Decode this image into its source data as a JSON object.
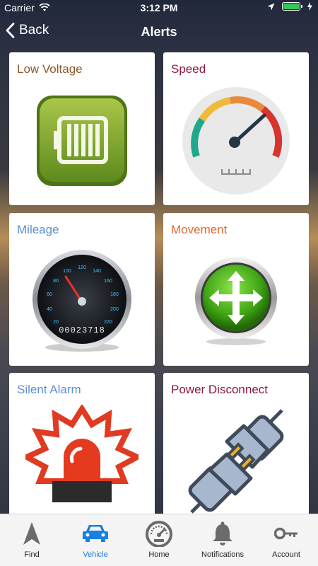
{
  "status_bar": {
    "carrier": "Carrier",
    "time": "3:12 PM"
  },
  "nav": {
    "back_label": "Back",
    "title": "Alerts"
  },
  "alerts": [
    {
      "label": "Low Voltage",
      "color": "#8b5a2b",
      "icon": "battery-icon"
    },
    {
      "label": "Speed",
      "color": "#8b1a3a",
      "icon": "speed-gauge-icon"
    },
    {
      "label": "Mileage",
      "color": "#5b8fd0",
      "icon": "odometer-icon"
    },
    {
      "label": "Movement",
      "color": "#e06a2a",
      "icon": "move-arrows-icon"
    },
    {
      "label": "Silent Alarm",
      "color": "#5b8fd0",
      "icon": "siren-icon"
    },
    {
      "label": "Power Disconnect",
      "color": "#8b1a3a",
      "icon": "plug-disconnect-icon"
    }
  ],
  "odometer": {
    "reading": "00023718",
    "ticks": [
      "20",
      "40",
      "60",
      "80",
      "100",
      "120",
      "140",
      "160",
      "180",
      "200",
      "220"
    ]
  },
  "tab_bar": [
    {
      "label": "Find",
      "icon": "navigation-arrow-icon"
    },
    {
      "label": "Vehicle",
      "icon": "car-icon",
      "active": true
    },
    {
      "label": "Home",
      "icon": "speedometer-icon"
    },
    {
      "label": "Notifications",
      "icon": "bell-icon"
    },
    {
      "label": "Account",
      "icon": "key-icon"
    }
  ],
  "colors": {
    "active_tab": "#1a7fe0",
    "inactive_tab": "#6b6b6b"
  }
}
